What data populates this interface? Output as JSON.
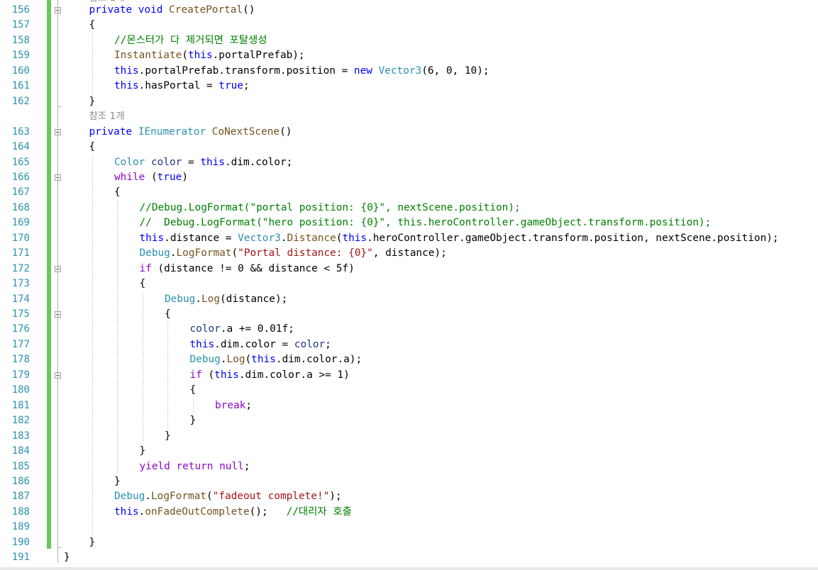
{
  "editor": {
    "codelens_ref": "참조 1개",
    "lines": [
      {
        "n": "156",
        "indent": 1,
        "tokens": [
          {
            "t": "private void ",
            "c": "kw"
          },
          {
            "t": "CreatePortal",
            "c": "fn"
          },
          {
            "t": "()",
            "c": ""
          }
        ]
      },
      {
        "n": "157",
        "indent": 1,
        "tokens": [
          {
            "t": "{",
            "c": ""
          }
        ]
      },
      {
        "n": "158",
        "indent": 2,
        "tokens": [
          {
            "t": "//몬스터가 다 제거되면 포탈생성",
            "c": "cm"
          }
        ]
      },
      {
        "n": "159",
        "indent": 2,
        "tokens": [
          {
            "t": "Instantiate",
            "c": "fn"
          },
          {
            "t": "(",
            "c": ""
          },
          {
            "t": "this",
            "c": "kw"
          },
          {
            "t": ".portalPrefab);",
            "c": ""
          }
        ]
      },
      {
        "n": "160",
        "indent": 2,
        "tokens": [
          {
            "t": "this",
            "c": "kw"
          },
          {
            "t": ".portalPrefab.transform.position = ",
            "c": ""
          },
          {
            "t": "new ",
            "c": "kw"
          },
          {
            "t": "Vector3",
            "c": "ty"
          },
          {
            "t": "(6, 0, 10);",
            "c": ""
          }
        ]
      },
      {
        "n": "161",
        "indent": 2,
        "tokens": [
          {
            "t": "this",
            "c": "kw"
          },
          {
            "t": ".hasPortal = ",
            "c": ""
          },
          {
            "t": "true",
            "c": "kw"
          },
          {
            "t": ";",
            "c": ""
          }
        ]
      },
      {
        "n": "162",
        "indent": 1,
        "tokens": [
          {
            "t": "}",
            "c": ""
          }
        ]
      },
      {
        "n": "163",
        "indent": 1,
        "tokens": [
          {
            "t": "private ",
            "c": "kw"
          },
          {
            "t": "IEnumerator ",
            "c": "ty"
          },
          {
            "t": "CoNextScene",
            "c": "fn"
          },
          {
            "t": "()",
            "c": ""
          }
        ]
      },
      {
        "n": "164",
        "indent": 1,
        "tokens": [
          {
            "t": "{",
            "c": ""
          }
        ]
      },
      {
        "n": "165",
        "indent": 2,
        "tokens": [
          {
            "t": "Color ",
            "c": "ty"
          },
          {
            "t": "color",
            "c": "var"
          },
          {
            "t": " = ",
            "c": ""
          },
          {
            "t": "this",
            "c": "kw"
          },
          {
            "t": ".dim.color;",
            "c": ""
          }
        ]
      },
      {
        "n": "166",
        "indent": 2,
        "tokens": [
          {
            "t": "while",
            "c": "ctl"
          },
          {
            "t": " (",
            "c": ""
          },
          {
            "t": "true",
            "c": "kw"
          },
          {
            "t": ")",
            "c": ""
          }
        ]
      },
      {
        "n": "167",
        "indent": 2,
        "tokens": [
          {
            "t": "{",
            "c": ""
          }
        ]
      },
      {
        "n": "168",
        "indent": 3,
        "tokens": [
          {
            "t": "//Debug.LogFormat(\"portal position: {0}\", nextScene.position);",
            "c": "cm"
          }
        ]
      },
      {
        "n": "169",
        "indent": 3,
        "tokens": [
          {
            "t": "//  Debug.LogFormat(\"hero position: {0}\", this.heroController.gameObject.transform.position);",
            "c": "cm"
          }
        ]
      },
      {
        "n": "170",
        "indent": 3,
        "tokens": [
          {
            "t": "this",
            "c": "kw"
          },
          {
            "t": ".distance = ",
            "c": ""
          },
          {
            "t": "Vector3",
            "c": "ty"
          },
          {
            "t": ".",
            "c": ""
          },
          {
            "t": "Distance",
            "c": "fn"
          },
          {
            "t": "(",
            "c": ""
          },
          {
            "t": "this",
            "c": "kw"
          },
          {
            "t": ".heroController.gameObject.transform.position, nextScene.position);",
            "c": ""
          }
        ]
      },
      {
        "n": "171",
        "indent": 3,
        "tokens": [
          {
            "t": "Debug",
            "c": "ty"
          },
          {
            "t": ".",
            "c": ""
          },
          {
            "t": "LogFormat",
            "c": "fn"
          },
          {
            "t": "(",
            "c": ""
          },
          {
            "t": "\"Portal distance: {0}\"",
            "c": "str"
          },
          {
            "t": ", distance);",
            "c": ""
          }
        ]
      },
      {
        "n": "172",
        "indent": 3,
        "tokens": [
          {
            "t": "if",
            "c": "ctl"
          },
          {
            "t": " (distance != 0 && distance < 5f)",
            "c": ""
          }
        ]
      },
      {
        "n": "173",
        "indent": 3,
        "tokens": [
          {
            "t": "{",
            "c": ""
          }
        ]
      },
      {
        "n": "174",
        "indent": 4,
        "tokens": [
          {
            "t": "Debug",
            "c": "ty"
          },
          {
            "t": ".",
            "c": ""
          },
          {
            "t": "Log",
            "c": "fn"
          },
          {
            "t": "(distance);",
            "c": ""
          }
        ]
      },
      {
        "n": "175",
        "indent": 4,
        "tokens": [
          {
            "t": "{",
            "c": ""
          }
        ]
      },
      {
        "n": "176",
        "indent": 5,
        "tokens": [
          {
            "t": "color",
            "c": "var"
          },
          {
            "t": ".a += 0.01f;",
            "c": ""
          }
        ]
      },
      {
        "n": "177",
        "indent": 5,
        "tokens": [
          {
            "t": "this",
            "c": "kw"
          },
          {
            "t": ".dim.color = ",
            "c": ""
          },
          {
            "t": "color",
            "c": "var"
          },
          {
            "t": ";",
            "c": ""
          }
        ]
      },
      {
        "n": "178",
        "indent": 5,
        "tokens": [
          {
            "t": "Debug",
            "c": "ty"
          },
          {
            "t": ".",
            "c": ""
          },
          {
            "t": "Log",
            "c": "fn"
          },
          {
            "t": "(",
            "c": ""
          },
          {
            "t": "this",
            "c": "kw"
          },
          {
            "t": ".dim.color.a);",
            "c": ""
          }
        ]
      },
      {
        "n": "179",
        "indent": 5,
        "tokens": [
          {
            "t": "if",
            "c": "ctl"
          },
          {
            "t": " (",
            "c": ""
          },
          {
            "t": "this",
            "c": "kw"
          },
          {
            "t": ".dim.color.a >= 1)",
            "c": ""
          }
        ]
      },
      {
        "n": "180",
        "indent": 5,
        "tokens": [
          {
            "t": "{",
            "c": ""
          }
        ]
      },
      {
        "n": "181",
        "indent": 6,
        "tokens": [
          {
            "t": "break",
            "c": "ctl"
          },
          {
            "t": ";",
            "c": ""
          }
        ]
      },
      {
        "n": "182",
        "indent": 5,
        "tokens": [
          {
            "t": "}",
            "c": ""
          }
        ]
      },
      {
        "n": "183",
        "indent": 4,
        "tokens": [
          {
            "t": "}",
            "c": ""
          }
        ]
      },
      {
        "n": "184",
        "indent": 3,
        "tokens": [
          {
            "t": "}",
            "c": ""
          }
        ]
      },
      {
        "n": "185",
        "indent": 3,
        "tokens": [
          {
            "t": "yield return null",
            "c": "ctl"
          },
          {
            "t": ";",
            "c": ""
          }
        ]
      },
      {
        "n": "186",
        "indent": 2,
        "tokens": [
          {
            "t": "}",
            "c": ""
          }
        ]
      },
      {
        "n": "187",
        "indent": 2,
        "tokens": [
          {
            "t": "Debug",
            "c": "ty"
          },
          {
            "t": ".",
            "c": ""
          },
          {
            "t": "LogFormat",
            "c": "fn"
          },
          {
            "t": "(",
            "c": ""
          },
          {
            "t": "\"fadeout complete!\"",
            "c": "str"
          },
          {
            "t": ");",
            "c": ""
          }
        ]
      },
      {
        "n": "188",
        "indent": 2,
        "tokens": [
          {
            "t": "this",
            "c": "kw"
          },
          {
            "t": ".",
            "c": ""
          },
          {
            "t": "onFadeOutComplete",
            "c": "fn"
          },
          {
            "t": "();   ",
            "c": ""
          },
          {
            "t": "//대리자 호출",
            "c": "cm"
          }
        ]
      },
      {
        "n": "189",
        "indent": 2,
        "tokens": []
      },
      {
        "n": "190",
        "indent": 1,
        "tokens": [
          {
            "t": "}",
            "c": ""
          }
        ]
      },
      {
        "n": "191",
        "indent": 0,
        "tokens": [
          {
            "t": "}",
            "c": ""
          }
        ]
      }
    ]
  },
  "colors": {
    "line_number": "#2b91af",
    "keyword": "#0000ff",
    "control": "#8f08c4",
    "type": "#2b91af",
    "string": "#a31515",
    "comment": "#008000",
    "method": "#74531f",
    "local": "#1f377f",
    "change_bar": "#64c85a"
  }
}
